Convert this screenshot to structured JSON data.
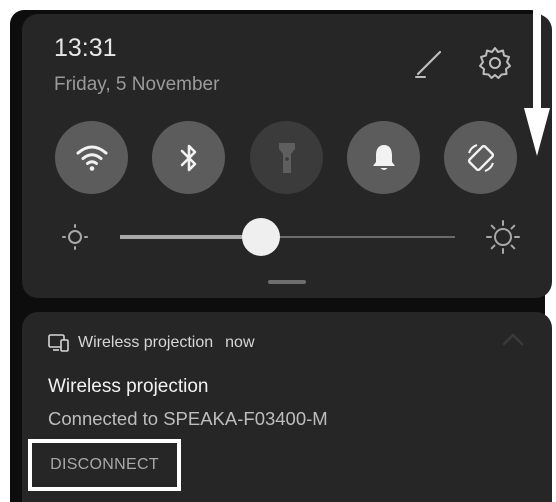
{
  "status": {
    "time": "13:31",
    "date": "Friday, 5 November"
  },
  "quick_settings": {
    "tiles": [
      {
        "name": "wifi",
        "icon": "wifi-icon",
        "state": "on"
      },
      {
        "name": "bluetooth",
        "icon": "bluetooth-icon",
        "state": "on"
      },
      {
        "name": "flashlight",
        "icon": "flashlight-icon",
        "state": "off"
      },
      {
        "name": "sound",
        "icon": "bell-icon",
        "state": "on"
      },
      {
        "name": "auto-rotate",
        "icon": "rotate-icon",
        "state": "on"
      }
    ],
    "header_icons": [
      "edit-icon",
      "settings-icon"
    ],
    "brightness": {
      "level": 0.42,
      "low_icon": "brightness-low-icon",
      "high_icon": "brightness-high-icon"
    }
  },
  "notification": {
    "app_icon": "cast-screen-icon",
    "app_name": "Wireless projection",
    "time": "now",
    "title": "Wireless projection",
    "body": "Connected to SPEAKA-F03400-M",
    "action_label": "DISCONNECT"
  },
  "annotation": {
    "arrow": "swipe-down-arrow-icon"
  },
  "colors": {
    "panel": "#262626",
    "tile_on": "#5c5c5c",
    "tile_off": "#3b3b3b",
    "highlight_box": "#ffffff"
  }
}
